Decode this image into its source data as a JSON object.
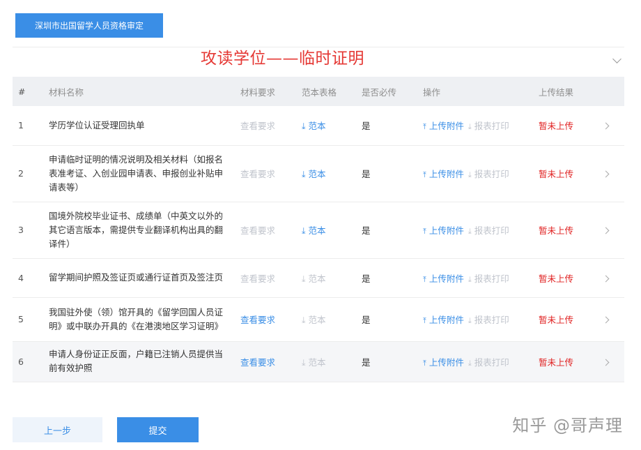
{
  "header": {
    "tab_label": "深圳市出国留学人员资格审定"
  },
  "overlay_title": "攻读学位——临时证明",
  "table": {
    "columns": [
      "#",
      "材料名称",
      "材料要求",
      "范本表格",
      "是否必传",
      "操作",
      "上传结果"
    ],
    "rows": [
      {
        "num": "1",
        "name": "学历学位认证受理回执单",
        "requirement": "查看要求",
        "requirement_active": false,
        "template": "范本",
        "template_active": true,
        "required": "是",
        "upload": "上传附件",
        "print": "报表打印",
        "result": "暂未上传"
      },
      {
        "num": "2",
        "name": "申请临时证明的情况说明及相关材料（如报名表准考证、入创业园申请表、申报创业补贴申请表等）",
        "requirement": "查看要求",
        "requirement_active": false,
        "template": "范本",
        "template_active": true,
        "required": "是",
        "upload": "上传附件",
        "print": "报表打印",
        "result": "暂未上传"
      },
      {
        "num": "3",
        "name": "国境外院校毕业证书、成绩单（中英文以外的其它语言版本，需提供专业翻译机构出具的翻译件）",
        "requirement": "查看要求",
        "requirement_active": false,
        "template": "范本",
        "template_active": true,
        "required": "是",
        "upload": "上传附件",
        "print": "报表打印",
        "result": "暂未上传"
      },
      {
        "num": "4",
        "name": "留学期间护照及签证页或通行证首页及签注页",
        "requirement": "查看要求",
        "requirement_active": false,
        "template": "范本",
        "template_active": false,
        "required": "是",
        "upload": "上传附件",
        "print": "报表打印",
        "result": "暂未上传"
      },
      {
        "num": "5",
        "name": "我国驻外使（领）馆开具的《留学回国人员证明》或中联办开具的《在港澳地区学习证明》",
        "requirement": "查看要求",
        "requirement_active": true,
        "template": "范本",
        "template_active": false,
        "required": "是",
        "upload": "上传附件",
        "print": "报表打印",
        "result": "暂未上传"
      },
      {
        "num": "6",
        "name": "申请人身份证正反面，户籍已注销人员提供当前有效护照",
        "requirement": "查看要求",
        "requirement_active": true,
        "template": "范本",
        "template_active": false,
        "required": "是",
        "upload": "上传附件",
        "print": "报表打印",
        "result": "暂未上传"
      }
    ]
  },
  "footer": {
    "prev_label": "上一步",
    "submit_label": "提交"
  },
  "watermark": "知乎 @哥声理",
  "colors": {
    "accent": "#3a8ee6",
    "status_red": "#e02020",
    "muted": "#c0c4cc"
  }
}
